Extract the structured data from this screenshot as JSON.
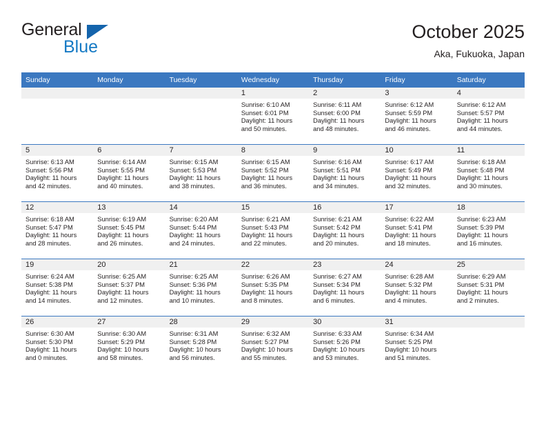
{
  "brand": {
    "name_part1": "General",
    "name_part2": "Blue",
    "triangle_color": "#1464ac",
    "blue_text_color": "#1479c4"
  },
  "header": {
    "title": "October 2025",
    "subtitle": "Aka, Fukuoka, Japan"
  },
  "theme": {
    "header_blue": "#3b78c0",
    "daynum_band": "#f0f0f0",
    "text": "#231f20"
  },
  "weekdays": [
    "Sunday",
    "Monday",
    "Tuesday",
    "Wednesday",
    "Thursday",
    "Friday",
    "Saturday"
  ],
  "labels": {
    "sunrise": "Sunrise:",
    "sunset": "Sunset:",
    "daylight": "Daylight:"
  },
  "weeks": [
    [
      {
        "day": "",
        "sunrise": "",
        "sunset": "",
        "daylight_line1": "",
        "daylight_line2": ""
      },
      {
        "day": "",
        "sunrise": "",
        "sunset": "",
        "daylight_line1": "",
        "daylight_line2": ""
      },
      {
        "day": "",
        "sunrise": "",
        "sunset": "",
        "daylight_line1": "",
        "daylight_line2": ""
      },
      {
        "day": "1",
        "sunrise": "Sunrise: 6:10 AM",
        "sunset": "Sunset: 6:01 PM",
        "daylight_line1": "Daylight: 11 hours",
        "daylight_line2": "and 50 minutes."
      },
      {
        "day": "2",
        "sunrise": "Sunrise: 6:11 AM",
        "sunset": "Sunset: 6:00 PM",
        "daylight_line1": "Daylight: 11 hours",
        "daylight_line2": "and 48 minutes."
      },
      {
        "day": "3",
        "sunrise": "Sunrise: 6:12 AM",
        "sunset": "Sunset: 5:59 PM",
        "daylight_line1": "Daylight: 11 hours",
        "daylight_line2": "and 46 minutes."
      },
      {
        "day": "4",
        "sunrise": "Sunrise: 6:12 AM",
        "sunset": "Sunset: 5:57 PM",
        "daylight_line1": "Daylight: 11 hours",
        "daylight_line2": "and 44 minutes."
      }
    ],
    [
      {
        "day": "5",
        "sunrise": "Sunrise: 6:13 AM",
        "sunset": "Sunset: 5:56 PM",
        "daylight_line1": "Daylight: 11 hours",
        "daylight_line2": "and 42 minutes."
      },
      {
        "day": "6",
        "sunrise": "Sunrise: 6:14 AM",
        "sunset": "Sunset: 5:55 PM",
        "daylight_line1": "Daylight: 11 hours",
        "daylight_line2": "and 40 minutes."
      },
      {
        "day": "7",
        "sunrise": "Sunrise: 6:15 AM",
        "sunset": "Sunset: 5:53 PM",
        "daylight_line1": "Daylight: 11 hours",
        "daylight_line2": "and 38 minutes."
      },
      {
        "day": "8",
        "sunrise": "Sunrise: 6:15 AM",
        "sunset": "Sunset: 5:52 PM",
        "daylight_line1": "Daylight: 11 hours",
        "daylight_line2": "and 36 minutes."
      },
      {
        "day": "9",
        "sunrise": "Sunrise: 6:16 AM",
        "sunset": "Sunset: 5:51 PM",
        "daylight_line1": "Daylight: 11 hours",
        "daylight_line2": "and 34 minutes."
      },
      {
        "day": "10",
        "sunrise": "Sunrise: 6:17 AM",
        "sunset": "Sunset: 5:49 PM",
        "daylight_line1": "Daylight: 11 hours",
        "daylight_line2": "and 32 minutes."
      },
      {
        "day": "11",
        "sunrise": "Sunrise: 6:18 AM",
        "sunset": "Sunset: 5:48 PM",
        "daylight_line1": "Daylight: 11 hours",
        "daylight_line2": "and 30 minutes."
      }
    ],
    [
      {
        "day": "12",
        "sunrise": "Sunrise: 6:18 AM",
        "sunset": "Sunset: 5:47 PM",
        "daylight_line1": "Daylight: 11 hours",
        "daylight_line2": "and 28 minutes."
      },
      {
        "day": "13",
        "sunrise": "Sunrise: 6:19 AM",
        "sunset": "Sunset: 5:45 PM",
        "daylight_line1": "Daylight: 11 hours",
        "daylight_line2": "and 26 minutes."
      },
      {
        "day": "14",
        "sunrise": "Sunrise: 6:20 AM",
        "sunset": "Sunset: 5:44 PM",
        "daylight_line1": "Daylight: 11 hours",
        "daylight_line2": "and 24 minutes."
      },
      {
        "day": "15",
        "sunrise": "Sunrise: 6:21 AM",
        "sunset": "Sunset: 5:43 PM",
        "daylight_line1": "Daylight: 11 hours",
        "daylight_line2": "and 22 minutes."
      },
      {
        "day": "16",
        "sunrise": "Sunrise: 6:21 AM",
        "sunset": "Sunset: 5:42 PM",
        "daylight_line1": "Daylight: 11 hours",
        "daylight_line2": "and 20 minutes."
      },
      {
        "day": "17",
        "sunrise": "Sunrise: 6:22 AM",
        "sunset": "Sunset: 5:41 PM",
        "daylight_line1": "Daylight: 11 hours",
        "daylight_line2": "and 18 minutes."
      },
      {
        "day": "18",
        "sunrise": "Sunrise: 6:23 AM",
        "sunset": "Sunset: 5:39 PM",
        "daylight_line1": "Daylight: 11 hours",
        "daylight_line2": "and 16 minutes."
      }
    ],
    [
      {
        "day": "19",
        "sunrise": "Sunrise: 6:24 AM",
        "sunset": "Sunset: 5:38 PM",
        "daylight_line1": "Daylight: 11 hours",
        "daylight_line2": "and 14 minutes."
      },
      {
        "day": "20",
        "sunrise": "Sunrise: 6:25 AM",
        "sunset": "Sunset: 5:37 PM",
        "daylight_line1": "Daylight: 11 hours",
        "daylight_line2": "and 12 minutes."
      },
      {
        "day": "21",
        "sunrise": "Sunrise: 6:25 AM",
        "sunset": "Sunset: 5:36 PM",
        "daylight_line1": "Daylight: 11 hours",
        "daylight_line2": "and 10 minutes."
      },
      {
        "day": "22",
        "sunrise": "Sunrise: 6:26 AM",
        "sunset": "Sunset: 5:35 PM",
        "daylight_line1": "Daylight: 11 hours",
        "daylight_line2": "and 8 minutes."
      },
      {
        "day": "23",
        "sunrise": "Sunrise: 6:27 AM",
        "sunset": "Sunset: 5:34 PM",
        "daylight_line1": "Daylight: 11 hours",
        "daylight_line2": "and 6 minutes."
      },
      {
        "day": "24",
        "sunrise": "Sunrise: 6:28 AM",
        "sunset": "Sunset: 5:32 PM",
        "daylight_line1": "Daylight: 11 hours",
        "daylight_line2": "and 4 minutes."
      },
      {
        "day": "25",
        "sunrise": "Sunrise: 6:29 AM",
        "sunset": "Sunset: 5:31 PM",
        "daylight_line1": "Daylight: 11 hours",
        "daylight_line2": "and 2 minutes."
      }
    ],
    [
      {
        "day": "26",
        "sunrise": "Sunrise: 6:30 AM",
        "sunset": "Sunset: 5:30 PM",
        "daylight_line1": "Daylight: 11 hours",
        "daylight_line2": "and 0 minutes."
      },
      {
        "day": "27",
        "sunrise": "Sunrise: 6:30 AM",
        "sunset": "Sunset: 5:29 PM",
        "daylight_line1": "Daylight: 10 hours",
        "daylight_line2": "and 58 minutes."
      },
      {
        "day": "28",
        "sunrise": "Sunrise: 6:31 AM",
        "sunset": "Sunset: 5:28 PM",
        "daylight_line1": "Daylight: 10 hours",
        "daylight_line2": "and 56 minutes."
      },
      {
        "day": "29",
        "sunrise": "Sunrise: 6:32 AM",
        "sunset": "Sunset: 5:27 PM",
        "daylight_line1": "Daylight: 10 hours",
        "daylight_line2": "and 55 minutes."
      },
      {
        "day": "30",
        "sunrise": "Sunrise: 6:33 AM",
        "sunset": "Sunset: 5:26 PM",
        "daylight_line1": "Daylight: 10 hours",
        "daylight_line2": "and 53 minutes."
      },
      {
        "day": "31",
        "sunrise": "Sunrise: 6:34 AM",
        "sunset": "Sunset: 5:25 PM",
        "daylight_line1": "Daylight: 10 hours",
        "daylight_line2": "and 51 minutes."
      },
      {
        "day": "",
        "sunrise": "",
        "sunset": "",
        "daylight_line1": "",
        "daylight_line2": ""
      }
    ]
  ]
}
